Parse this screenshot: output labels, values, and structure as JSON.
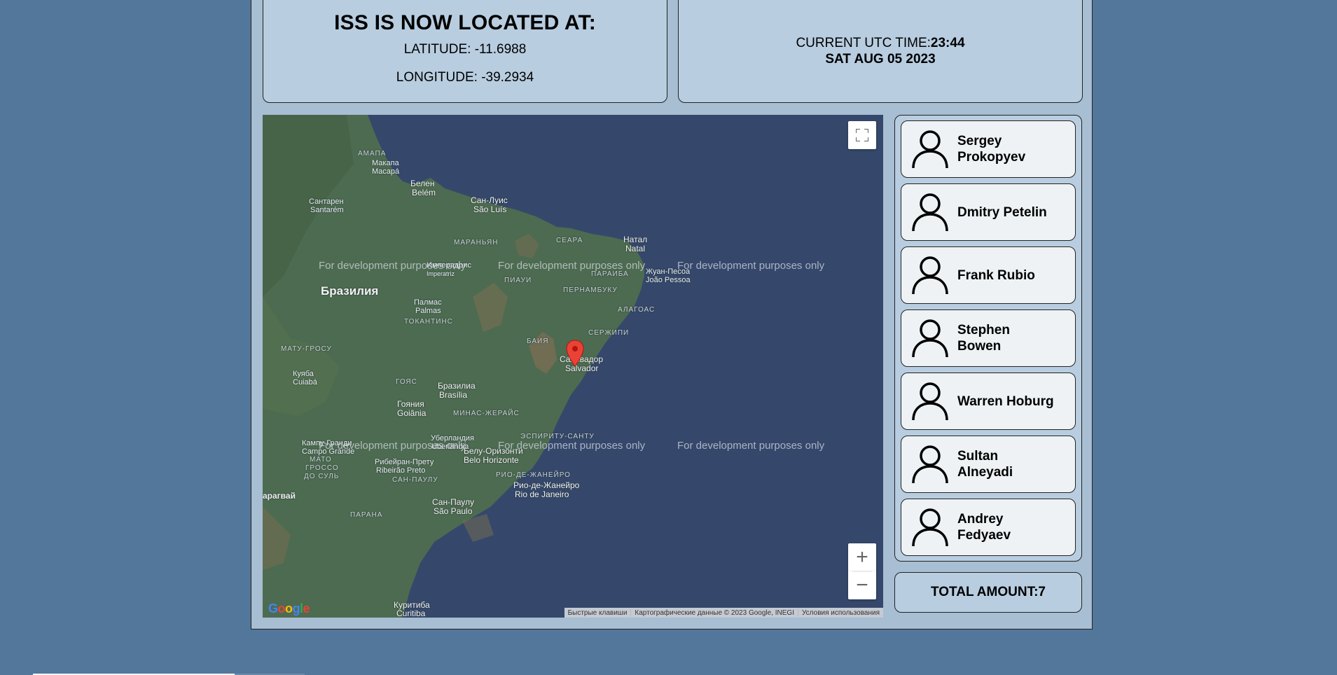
{
  "location": {
    "title": "ISS IS NOW LOCATED AT:",
    "latitude_label": "LATITUDE:",
    "latitude": "-11.6988",
    "longitude_label": "LONGITUDE:",
    "longitude": "-39.2934"
  },
  "time": {
    "label": "CURRENT UTC TIME:",
    "value": "23:44",
    "date": "SAT AUG 05 2023"
  },
  "map": {
    "watermark": "For development purposes only",
    "labels": {
      "amapa": "АМАПА",
      "makapa": "Макапа",
      "macapa": "Macapá",
      "belen": "Белен",
      "belem": "Belém",
      "santaren": "Сантарен",
      "santarem": "Santarém",
      "san_luis": "Сан-Луис",
      "sao_luis": "São Luís",
      "maranyan": "МАРАНЬЯН",
      "seara": "СЕАРА",
      "natal_ru": "Натал",
      "natal": "Natal",
      "imperatriz_ru": "Имперадрис",
      "imperatriz": "Imperatriz",
      "paraiba": "ПАРАИБА",
      "joao_pessoa_ru": "Жуан-Песоа",
      "joao_pessoa": "João Pessoa",
      "piaui": "ПИАУИ",
      "pernambuku": "ПЕРНАМБУКУ",
      "braziliya": "Бразилия",
      "palmas_ru": "Палмас",
      "palmas": "Palmas",
      "alagoas": "АЛАГОАС",
      "tokantins": "ТОКАНТИНС",
      "serzhipi": "СЕРЖИПИ",
      "baiya": "БАИЯ",
      "mato_grosu": "МАТУ-ГРОСУ",
      "salvador_ru": "Сальвадор",
      "salvador": "Salvador",
      "kuyaba": "Куяба",
      "cuiaba": "Cuiabá",
      "goias": "ГОЯС",
      "brasilia_ru": "Бразилиа",
      "brasilia": "Brasília",
      "goiania_ru": "Гояния",
      "goiania": "Goiânia",
      "minas_zherais": "МИНАС-ЖЕРАЙС",
      "espiritu_santu": "ЭСПИРИТУ-САНТУ",
      "uberlandia_ru": "Уберландия",
      "uberlandia": "Uberlândia",
      "kampu_grandi": "Кампу-Гранди",
      "campo_grande": "Campo Grande",
      "belu_orizonti": "Белу-Оризонти",
      "belo_horizonte": "Belo Horizonte",
      "mato_grosso_do_sul_1": "МАТО",
      "mato_grosso_do_sul_2": "ГРОССО",
      "mato_grosso_do_sul_3": "ДО СУЛЬ",
      "ribeirao_preto_ru": "Рибейран-Прету",
      "ribeirao_preto": "Ribeirão Preto",
      "rio_de_zhaneiro": "РИО-ДЕ-ЖАНЕЙРО",
      "san_paulu": "САН-ПАУЛУ",
      "rio_ru": "Рио-де-Жанейро",
      "rio": "Rio de Janeiro",
      "paragvai": "арагвай",
      "san_paulo_ru": "Сан-Паулу",
      "sao_paulo": "São Paulo",
      "parana": "ПАРАНА",
      "kuritiba": "Куритиба",
      "curitiba": "Curitiba"
    },
    "attribution": {
      "shortcuts": "Быстрые клавиши",
      "data": "Картографические данные © 2023 Google, INEGI",
      "terms": "Условия использования"
    },
    "controls": {
      "zoom_in": "+",
      "zoom_out": "−"
    },
    "logo": {
      "g1": "G",
      "g2": "o",
      "g3": "o",
      "g4": "g",
      "g5": "l",
      "g6": "e"
    }
  },
  "crew": [
    {
      "name": "Sergey Prokopyev",
      "icon": "user-icon"
    },
    {
      "name": "Dmitry Petelin",
      "icon": "user-icon"
    },
    {
      "name": "Frank Rubio",
      "icon": "user-icon"
    },
    {
      "name": "Stephen Bowen",
      "icon": "user-icon"
    },
    {
      "name": "Warren Hoburg",
      "icon": "user-icon"
    },
    {
      "name": "Sultan Alneyadi",
      "icon": "user-icon"
    },
    {
      "name": "Andrey Fedyaev",
      "icon": "user-icon"
    }
  ],
  "total": {
    "label": "TOTAL AMOUNT:",
    "value": "7"
  },
  "colors": {
    "page_bg": "#52779a",
    "panel_bg": "#b8cde0",
    "card_bg": "#eef2f5",
    "ocean": "#35486b",
    "land": "#4d6b50",
    "marker": "#ea4335"
  }
}
